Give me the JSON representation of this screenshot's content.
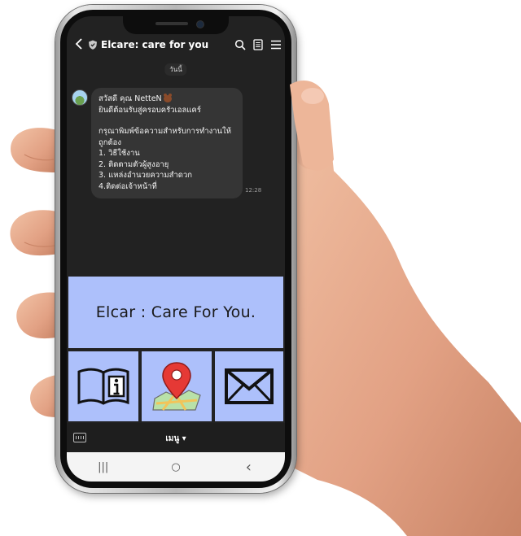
{
  "header": {
    "title": "Elcare: care for you",
    "icons": [
      "back-icon",
      "shield-icon",
      "search-icon",
      "notes-icon",
      "menu-icon"
    ]
  },
  "chat": {
    "date_label": "วันนี้",
    "message": {
      "lines": [
        "สวัสดี คุณ NetteN",
        "ยินดีต้อนรับสู่ครอบครัวเอลแคร์",
        "",
        "กรุณาพิมพ์ข้อความสำหรับการทำงานให้",
        "ถูกต้อง",
        "1. วิธีใช้งาน",
        "2. ติดตามตัวผู้สูงอายุ",
        "3. แหล่งอำนวยความสำดวก",
        "4.ติดต่อเจ้าหน้าที่"
      ],
      "time": "12:28"
    }
  },
  "richmenu": {
    "banner_text": "Elcar : Care For You.",
    "tiles": [
      {
        "icon": "book-info-icon"
      },
      {
        "icon": "map-pin-icon"
      },
      {
        "icon": "envelope-icon"
      }
    ],
    "accent_color": "#adc0fb"
  },
  "menubar": {
    "label": "เมนู ▾"
  },
  "navbar": {
    "recent": "|||",
    "home": "○",
    "back": "‹"
  }
}
